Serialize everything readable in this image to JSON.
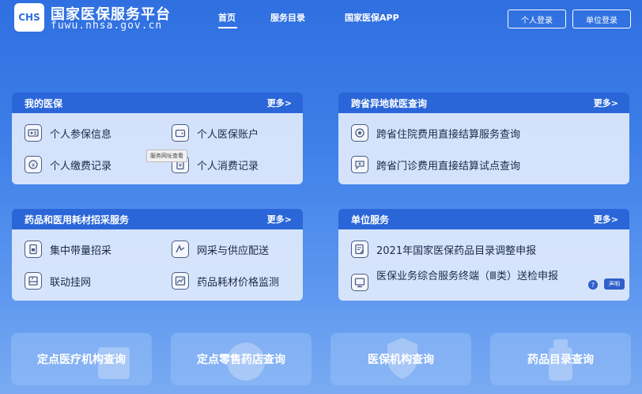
{
  "header": {
    "logo_text": "CHS",
    "site_title": "国家医保服务平台",
    "site_domain": "fuwu.nhsa.gov.cn",
    "nav": [
      "首页",
      "服务目录",
      "国家医保APP"
    ],
    "btn_personal": "个人登录",
    "btn_unit": "单位登录"
  },
  "panels": [
    {
      "title": "我的医保",
      "more": "更多>",
      "items": [
        {
          "label": "个人参保信息",
          "icon": "id-card-icon"
        },
        {
          "label": "个人医保账户",
          "icon": "wallet-icon"
        },
        {
          "label": "个人缴费记录",
          "icon": "payment-icon"
        },
        {
          "label": "个人消费记录",
          "icon": "receipt-icon"
        }
      ],
      "tooltip": "服务网址查看"
    },
    {
      "title": "跨省异地就医查询",
      "more": "更多>",
      "items": [
        {
          "label": "跨省住院费用直接结算服务查询",
          "icon": "location-icon"
        },
        {
          "label": "跨省门诊费用直接结算试点查询",
          "icon": "chat-medical-icon"
        }
      ]
    },
    {
      "title": "药品和医用耗材招采服务",
      "more": "更多>",
      "items": [
        {
          "label": "集中带量招采",
          "icon": "document-lock-icon"
        },
        {
          "label": "网采与供应配送",
          "icon": "delivery-icon"
        },
        {
          "label": "联动挂网",
          "icon": "network-icon"
        },
        {
          "label": "药品耗材价格监测",
          "icon": "chart-image-icon"
        }
      ]
    },
    {
      "title": "单位服务",
      "more": "更多>",
      "items": [
        {
          "label": "2021年国家医保药品目录调整申报",
          "icon": "form-edit-icon"
        },
        {
          "label": "医保业务综合服务终端（Ⅲ类）送检申报",
          "icon": "monitor-icon"
        }
      ],
      "badge_dot": "?",
      "badge_chip": "声明"
    }
  ],
  "tiles": [
    {
      "label": "定点医疗机构查询"
    },
    {
      "label": "定点零售药店查询"
    },
    {
      "label": "医保机构查询"
    },
    {
      "label": "药品目录查询"
    }
  ]
}
